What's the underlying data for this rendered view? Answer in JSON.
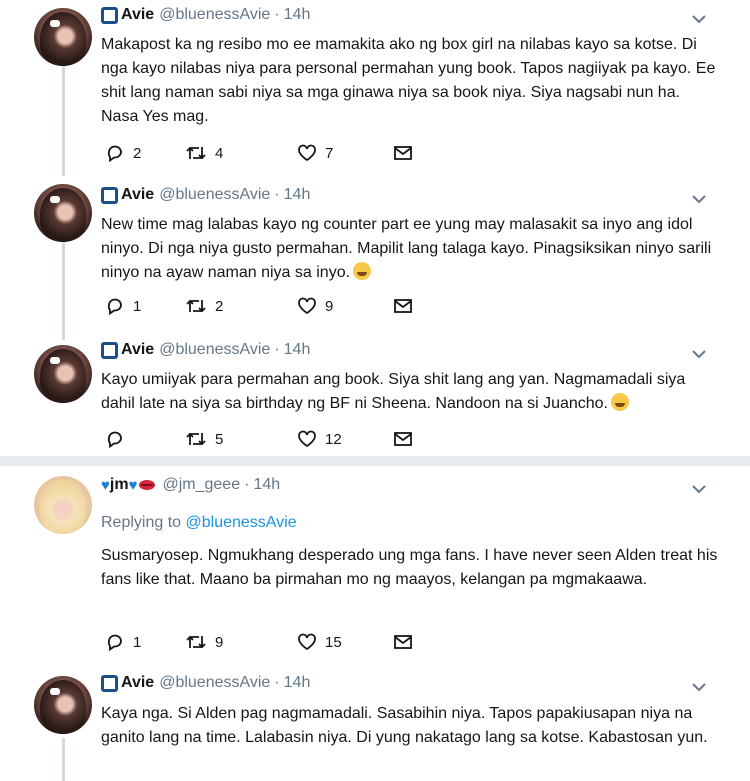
{
  "tweets": [
    {
      "name": "Avie",
      "handle": "@bluenessAvie",
      "time": "14h",
      "text": "Makapost ka ng resibo mo ee mamakita ako ng box girl na nilabas kayo sa kotse. Di nga kayo nilabas niya para personal permahan yung book. Tapos nagiiyak pa kayo. Ee shit lang naman sabi niya sa mga ginawa niya sa book niya. Siya nagsabi nun ha. Nasa  Yes mag.",
      "replies": "2",
      "retweets": "4",
      "likes": "7"
    },
    {
      "name": "Avie",
      "handle": "@bluenessAvie",
      "time": "14h",
      "text": "New time mag lalabas kayo ng counter part ee yung may malasakit sa inyo ang idol ninyo. Di nga niya gusto permahan. Mapilit lang talaga kayo. Pinagsiksikan ninyo sarili ninyo na ayaw naman niya sa inyo.",
      "replies": "1",
      "retweets": "2",
      "likes": "9"
    },
    {
      "name": "Avie",
      "handle": "@bluenessAvie",
      "time": "14h",
      "text": "Kayo umiiyak para permahan ang book. Siya shit lang ang yan. Nagmamadali siya dahil late na siya sa birthday ng BF ni Sheena. Nandoon na si Juancho.",
      "replies": "",
      "retweets": "5",
      "likes": "12"
    },
    {
      "name": "jm",
      "handle": "@jm_geee",
      "time": "14h",
      "replying_label": "Replying to",
      "replying_to": "@bluenessAvie",
      "text": "Susmaryosep. Ngmukhang desperado ung mga fans. I have never seen Alden treat his fans like that. Maano ba pirmahan mo ng maayos, kelangan pa mgmakaawa.",
      "replies": "1",
      "retweets": "9",
      "likes": "15"
    },
    {
      "name": "Avie",
      "handle": "@bluenessAvie",
      "time": "14h",
      "text": "Kaya nga. Si Alden pag nagmamadali. Sasabihin niya. Tapos papakiusapan niya na ganito lang na time. Lalabasin niya. Di yung nakatago lang sa kotse. Kabastosan yun."
    }
  ],
  "dot": "·",
  "colors": {
    "accent": "#1b95e0",
    "muted": "#657786",
    "separator": "#e6ecf0",
    "thread": "#cfd9de"
  }
}
